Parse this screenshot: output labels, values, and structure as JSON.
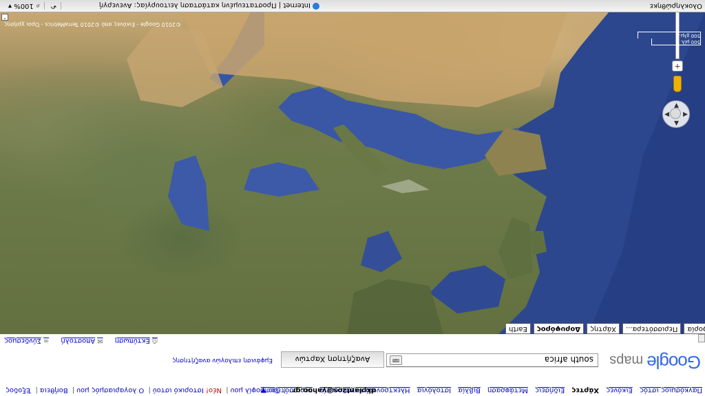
{
  "topbar": {
    "links": [
      "Παγκόσμιος ιστός",
      "Εικόνες"
    ],
    "active": "Χάρτες",
    "more_links": [
      "Ειδήσεις",
      "Μετάφραση",
      "Βιβλία",
      "Ιστολόγια",
      "Ηλεκτρονικό ταχυδρομείο"
    ],
    "more_menu": "περισσότερα ▼",
    "user": "dkplantzos@yahoo.gr",
    "right_links": [
      "Το προφίλ μου",
      "Νέο!",
      "Ιστορικό ιστού",
      "Ο λογαριασμός μου",
      "Βοήθεια",
      "Έξοδος"
    ]
  },
  "header": {
    "logo_word": "Google",
    "logo_suffix": "maps",
    "search_value": "south africa",
    "search_button": "Αναζήτηση Χαρτών",
    "search_options": "Εμφάνιση επιλογών αναζήτησης"
  },
  "actions": {
    "print": "Εκτύπωση",
    "send": "Αποστολή",
    "link": "Σύνδεσμος"
  },
  "map": {
    "types": [
      "Κυκλοφορία",
      "Περισσότερα...",
      "Χάρτης",
      "Δορυφόρος",
      "Earth"
    ],
    "active_type": "Δορυφόρος",
    "scale_top": "500 μίλ.",
    "scale_bottom": "500 χλμ.",
    "copyright": "©2010 Google - Εικόνες από ©2010 TerraMetrics - Όροι χρήσης"
  },
  "status": {
    "left": "Ολοκληρώθηκε",
    "zone": "Internet | Προστατευμένη κατάσταση λειτουργίας: Ανενεργή",
    "zoom": "100%"
  },
  "colors": {
    "link": "#0000cc",
    "sea": "#34509a",
    "land": "#6b7a48"
  }
}
